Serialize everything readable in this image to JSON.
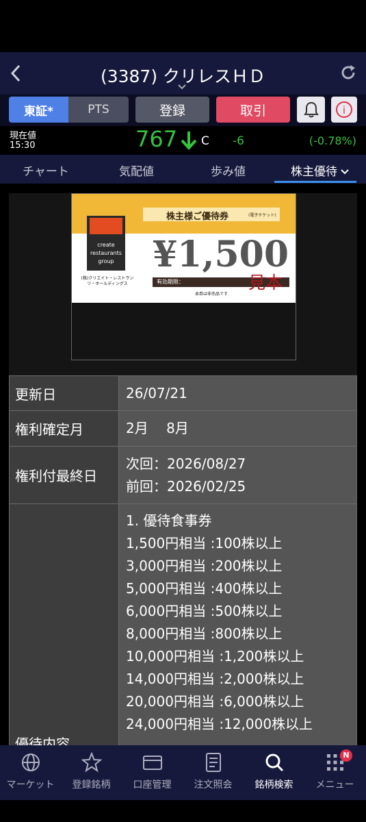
{
  "header": {
    "title": "(3387) クリレスＨＤ"
  },
  "buttons": {
    "tse": "東証*",
    "pts": "PTS",
    "register": "登録",
    "trade": "取引",
    "info_glyph": "i"
  },
  "price": {
    "label": "現在値",
    "time": "15:30",
    "value": "767",
    "mark": "C",
    "change": "-6",
    "change_pct": "(-0.78%)"
  },
  "tabs": {
    "chart": "チャート",
    "quote": "気配値",
    "ticks": "歩み値",
    "benefit": "株主優待"
  },
  "ticket": {
    "heading": "株主様ご優待券",
    "heading_sub": "(電子チケット)",
    "logo_lines": [
      "create",
      "restaurants",
      "group"
    ],
    "company": "(株)クリエイト・レストランツ・ホールディングス",
    "amount": "¥1,500",
    "expiry": "有効期限：",
    "sample": "見本",
    "not_for_sale": "本券は非売品です"
  },
  "info": {
    "updated_label": "更新日",
    "updated_value": "26/07/21",
    "record_month_label": "権利確定月",
    "record_month_value": "2月　 8月",
    "last_day_label": "権利付最終日",
    "last_day_next": "次回：2026/08/27",
    "last_day_prev": "前回：2026/02/25",
    "benefit_label": "優待内容",
    "benefit_title": "1.  優待食事券",
    "benefit_lines": [
      "1,500円相当 :100株以上",
      "3,000円相当 :200株以上",
      "5,000円相当 :400株以上",
      "6,000円相当 :500株以上",
      "8,000円相当 :800株以上",
      "10,000円相当 :1,200株以上",
      "14,000円相当 :2,000株以上",
      "20,000円相当 :6,000株以上",
      "24,000円相当 :12,000株以上"
    ]
  },
  "nav": {
    "market": "マーケット",
    "watchlist": "登録銘柄",
    "account": "口座管理",
    "orders": "注文照会",
    "search": "銘柄検索",
    "menu": "メニュー",
    "badge": "N"
  },
  "colors": {
    "up_down_green": "#35c43c",
    "trade_red": "#e04a63",
    "tse_blue": "#4f80e6",
    "header_navy": "#16193c"
  }
}
